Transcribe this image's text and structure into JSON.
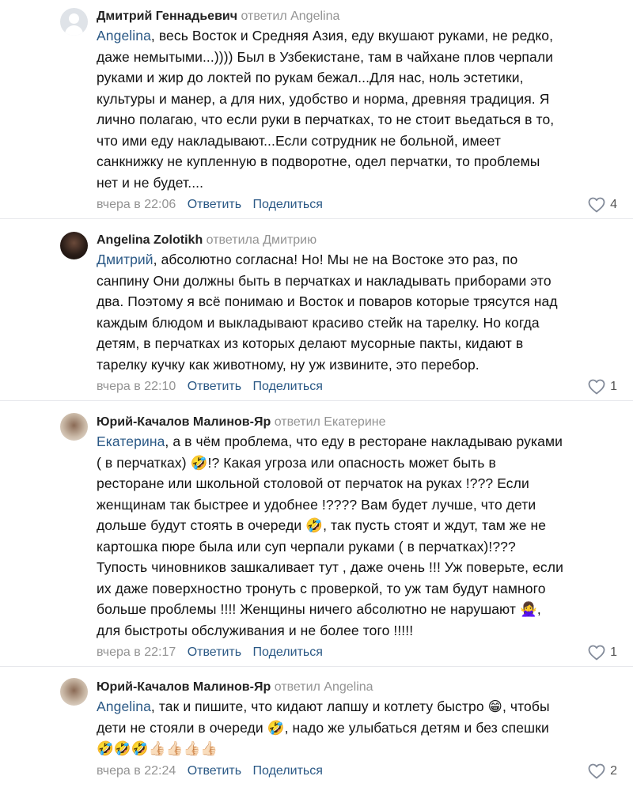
{
  "comments": [
    {
      "author": "Дмитрий Геннадьевич",
      "replied_text": "ответил Angelina",
      "mention": "Angelina",
      "text_lines": [
        ", весь Восток и Средняя Азия, еду вкушают руками, не редко,",
        "даже немытыми...)))) Был в Узбекистане, там в чайхане плов черпали",
        "руками и жир до локтей по рукам бежал...Для нас, ноль эстетики,",
        "культуры и манер, а для них, удобство и норма, древняя традиция. Я",
        "лично полагаю, что если руки в перчатках, то не стоит вьедаться в то,",
        "что ими еду накладывают...Если сотрудник не больной, имеет",
        "санкнижку не купленную в подворотне, одел перчатки, то проблемы",
        "нет и не будет...."
      ],
      "date": "вчера в 22:06",
      "reply_label": "Ответить",
      "share_label": "Поделиться",
      "likes": "4",
      "avatar": "default-avatar-icon"
    },
    {
      "author": "Angelina Zolotikh",
      "replied_text": "ответила Дмитрию",
      "mention": "Дмитрий",
      "text_lines": [
        ", абсолютно согласна! Но! Мы не на Востоке это раз, по",
        "санпину Они должны быть в перчатках и накладывать приборами это",
        "два. Поэтому я всё понимаю и Восток и поваров которые трясутся над",
        "каждым блюдом и выкладывают красиво стейк на тарелку. Но когда",
        "детям, в перчатках из которых делают мусорные пакты, кидают в",
        "тарелку кучку как животному, ну уж извините, это перебор."
      ],
      "date": "вчера в 22:10",
      "reply_label": "Ответить",
      "share_label": "Поделиться",
      "likes": "1",
      "avatar": "user-photo"
    },
    {
      "author": "Юрий-Качалов Малинов-Яр",
      "replied_text": "ответил Екатерине",
      "mention": "Екатерина",
      "text_lines": [
        ", а в чём проблема, что еду в ресторане накладываю руками",
        "( в перчатках) 🤣!? Какая угроза или опасность может быть в",
        "ресторане или школьной столовой от перчаток на руках !??? Если",
        "женщинам так быстрее и удобнее !???? Вам будет лучше, что дети",
        "дольше будут стоять в очереди 🤣, так пусть стоят и ждут, там же не",
        "картошка пюре была или суп черпали руками ( в перчатках)!???",
        "Тупость чиновников зашкаливает тут , даже очень !!! Уж поверьте, если",
        "их даже поверхностно тронуть с проверкой, то уж там будут намного",
        "больше проблемы !!!! Женщины ничего абсолютно не нарушают 🙅‍♀️,",
        "для быстроты обслуживания и не более того !!!!!"
      ],
      "date": "вчера в 22:17",
      "reply_label": "Ответить",
      "share_label": "Поделиться",
      "likes": "1",
      "avatar": "user-photo"
    },
    {
      "author": "Юрий-Качалов Малинов-Яр",
      "replied_text": "ответил Angelina",
      "mention": "Angelina",
      "text_lines": [
        ", так и пишите, что кидают лапшу и котлету быстро 😁, чтобы",
        "дети не стояли в очереди 🤣, надо же улыбаться детям и без спешки",
        "🤣🤣🤣👍🏻👍🏻👍🏻👍🏻"
      ],
      "date": "вчера в 22:24",
      "reply_label": "Ответить",
      "share_label": "Поделиться",
      "likes": "2",
      "avatar": "user-photo"
    }
  ],
  "icons": {
    "like": "heart-outline-icon"
  },
  "colors": {
    "link": "#2a5885",
    "meta": "#939393",
    "divider": "#e7e8ec"
  }
}
